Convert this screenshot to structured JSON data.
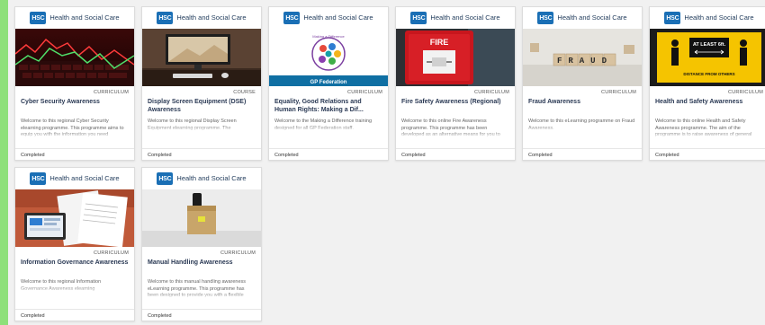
{
  "header": {
    "badge": "HSC",
    "org_name": "Health and Social Care"
  },
  "courses": [
    {
      "type": "CURRICULUM",
      "title": "Cyber Security Awareness",
      "desc": "Welcome to this regional Cyber Security elearning programme. This programme aims to equip you with the information you need",
      "status": "Completed",
      "thumbnail": "cyber-graph-keyboard"
    },
    {
      "type": "COURSE",
      "title": "Display Screen Equipment (DSE) Awareness",
      "desc": "Welcome to this regional Display Screen Equipment elearning programme. The",
      "status": "Completed",
      "thumbnail": "desk-monitor"
    },
    {
      "type": "CURRICULUM",
      "title": "Equality, Good Relations and Human Rights: Making a Dif...",
      "desc": "Welcome to the Making a Difference training designed for all GP Federation staff.",
      "status": "Completed",
      "thumbnail": "gp-federation-logo",
      "thumb_text": {
        "ring": "Making a Difference",
        "caption": "GP Federation"
      }
    },
    {
      "type": "CURRICULUM",
      "title": "Fire Safety Awareness (Regional)",
      "desc": "Welcome to this online Fire Awareness programme. This programme has been developed as an alternative means for you to",
      "status": "Completed",
      "thumbnail": "fire-alarm",
      "thumb_text": {
        "sign": "FIRE"
      }
    },
    {
      "type": "CURRICULUM",
      "title": "Fraud Awareness",
      "desc": "Welcome to this eLearning programme on Fraud Awareness.",
      "status": "Completed",
      "thumbnail": "fraud-blocks",
      "thumb_text": {
        "word": "FRAUD"
      }
    },
    {
      "type": "CURRICULUM",
      "title": "Health and Safety Awareness",
      "desc": "Welcome to this online Health and Safety Awareness programme. The aim of the programme is to raise awareness of general",
      "status": "Completed",
      "thumbnail": "distance-sign",
      "thumb_text": {
        "top": "AT LEAST 6ft.",
        "bottom": "DISTANCE FROM OTHERS"
      }
    },
    {
      "type": "CURRICULUM",
      "title": "Information Governance Awareness",
      "desc": "Welcome to this regional Information Governance Awareness elearning",
      "status": "Completed",
      "thumbnail": "documents-laptop"
    },
    {
      "type": "CURRICULUM",
      "title": "Manual Handling Awareness",
      "desc": "Welcome to this manual handling awareness eLearning programme. This programme has been designed to provide you with a flexible",
      "status": "Completed",
      "thumbnail": "cardboard-box"
    }
  ],
  "colors": {
    "accent_frame": "#8ee07a",
    "hsc_blue": "#1a6fb5",
    "title": "#2b3a55"
  }
}
